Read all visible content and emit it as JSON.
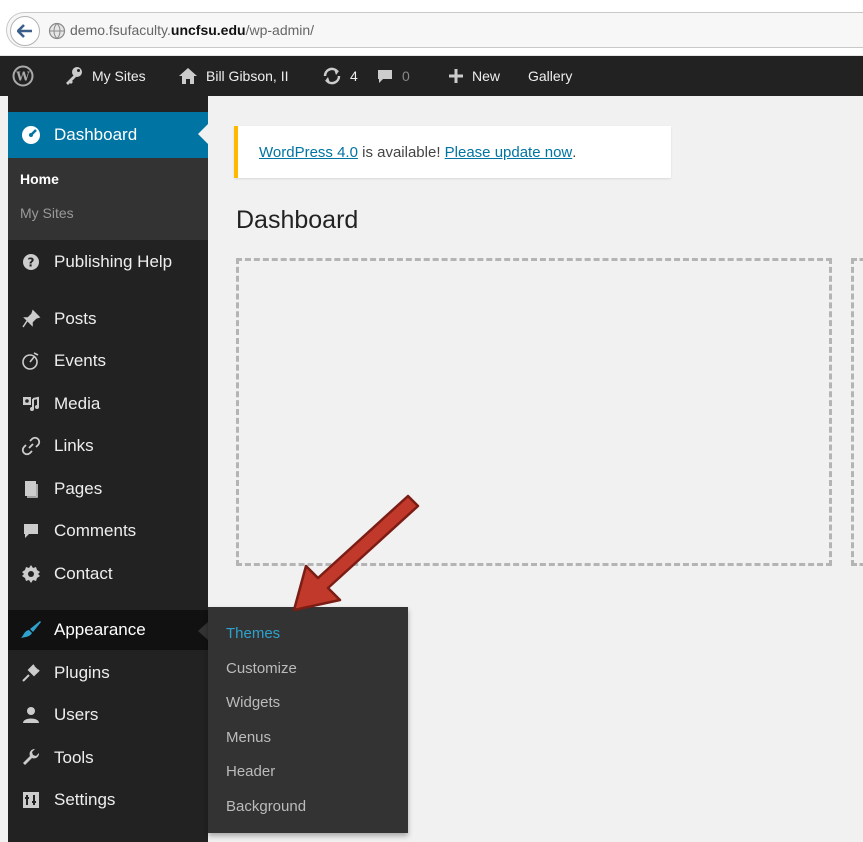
{
  "browser": {
    "url_prefix": "demo.fsufaculty.",
    "url_domain": "uncfsu.edu",
    "url_path": "/wp-admin/"
  },
  "adminbar": {
    "my_sites": "My Sites",
    "site_name": "Bill Gibson, II",
    "updates_count": "4",
    "comments_count": "0",
    "new_label": "New",
    "gallery_label": "Gallery"
  },
  "sidebar": {
    "dashboard": "Dashboard",
    "submenu": {
      "home": "Home",
      "my_sites": "My Sites"
    },
    "items": [
      {
        "label": "Publishing Help",
        "icon": "question-icon"
      },
      {
        "label": "Posts",
        "icon": "pin-icon"
      },
      {
        "label": "Events",
        "icon": "clock-icon"
      },
      {
        "label": "Media",
        "icon": "media-icon"
      },
      {
        "label": "Links",
        "icon": "link-icon"
      },
      {
        "label": "Pages",
        "icon": "pages-icon"
      },
      {
        "label": "Comments",
        "icon": "comment-icon"
      },
      {
        "label": "Contact",
        "icon": "gear-icon"
      },
      {
        "label": "Appearance",
        "icon": "brush-icon"
      },
      {
        "label": "Plugins",
        "icon": "plug-icon"
      },
      {
        "label": "Users",
        "icon": "user-icon"
      },
      {
        "label": "Tools",
        "icon": "wrench-icon"
      },
      {
        "label": "Settings",
        "icon": "settings-icon"
      }
    ]
  },
  "flyout": {
    "items": [
      "Themes",
      "Customize",
      "Widgets",
      "Menus",
      "Header",
      "Background"
    ]
  },
  "notice": {
    "version_link": "WordPress 4.0",
    "middle_text": " is available! ",
    "update_link": "Please update now",
    "end_text": "."
  },
  "main": {
    "title": "Dashboard"
  },
  "colors": {
    "accent": "#0074a2",
    "highlight": "#2ea2cc",
    "notice_border": "#ffba00",
    "annotation_arrow": "#c0392b"
  }
}
